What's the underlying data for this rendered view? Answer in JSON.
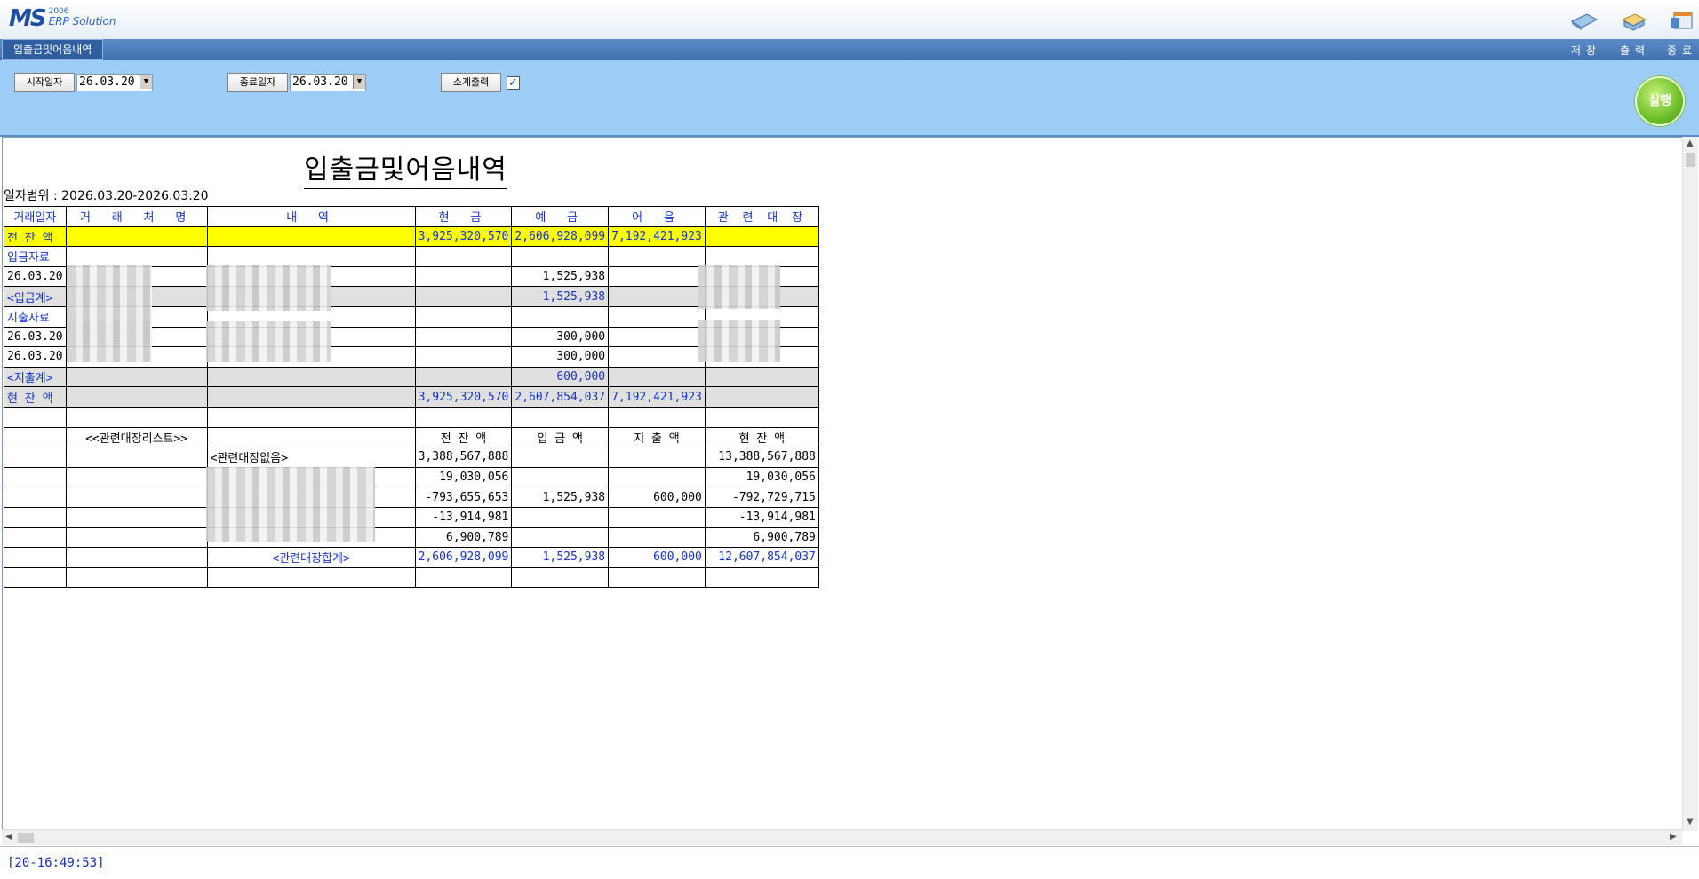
{
  "app": {
    "logo_main": "MS",
    "logo_year": "2006",
    "logo_sub": "ERP Solution",
    "tab_title": "입출금및어음내역",
    "toolbar": {
      "save": "저장",
      "print": "출력",
      "exit": "종료"
    }
  },
  "filter": {
    "start_label": "시작일자",
    "start_value": "26.03.20",
    "end_label": "종료일자",
    "end_value": "26.03.20",
    "subtotal_label": "소계출력",
    "subtotal_checked": true,
    "run_label": "실행"
  },
  "report": {
    "title": "입출금및어음내역",
    "range": "일자범위 : 2026.03.20-2026.03.20",
    "headers": [
      "거래일자",
      "거 래 처 명",
      "내 역",
      "현 금",
      "예 금",
      "어 음",
      "관 련 대 장"
    ],
    "rows": {
      "prev_balance": {
        "label": "전 잔 액",
        "cash": "3,925,320,570",
        "deposit": "2,606,928,099",
        "bill": "7,192,421,923"
      },
      "income_label": "입금자료",
      "income_row": {
        "date": "26.03.20",
        "deposit": "1,525,938"
      },
      "income_total": {
        "label": "<입금계>",
        "deposit": "1,525,938"
      },
      "expense_label": "지출자료",
      "expense_rows": [
        {
          "date": "26.03.20",
          "deposit": "300,000"
        },
        {
          "date": "26.03.20",
          "deposit": "300,000"
        }
      ],
      "expense_total": {
        "label": "<지출계>",
        "deposit": "600,000"
      },
      "curr_balance": {
        "label": "현 잔 액",
        "cash": "3,925,320,570",
        "deposit": "2,607,854,037",
        "bill": "7,192,421,923"
      }
    },
    "ledger": {
      "list_label": "<<관련대장리스트>>",
      "col_prev": "전 잔 액",
      "col_in": "입 금 액",
      "col_out": "지 출 액",
      "col_curr": "현 잔 액",
      "rows": [
        {
          "name": "<관련대장없음>",
          "prev": "3,388,567,888",
          "in": "",
          "out": "",
          "curr": "13,388,567,888"
        },
        {
          "name": "",
          "prev": "19,030,056",
          "in": "",
          "out": "",
          "curr": "19,030,056"
        },
        {
          "name": "",
          "prev": "-793,655,653",
          "in": "1,525,938",
          "out": "600,000",
          "curr": "-792,729,715"
        },
        {
          "name": "",
          "prev": "-13,914,981",
          "in": "",
          "out": "",
          "curr": "-13,914,981"
        },
        {
          "name": "",
          "prev": "6,900,789",
          "in": "",
          "out": "",
          "curr": "6,900,789"
        }
      ],
      "total": {
        "name": "<관련대장합계>",
        "prev": "2,606,928,099",
        "in": "1,525,938",
        "out": "600,000",
        "curr": "12,607,854,037"
      }
    }
  },
  "status_text": "[20-16:49:53]"
}
